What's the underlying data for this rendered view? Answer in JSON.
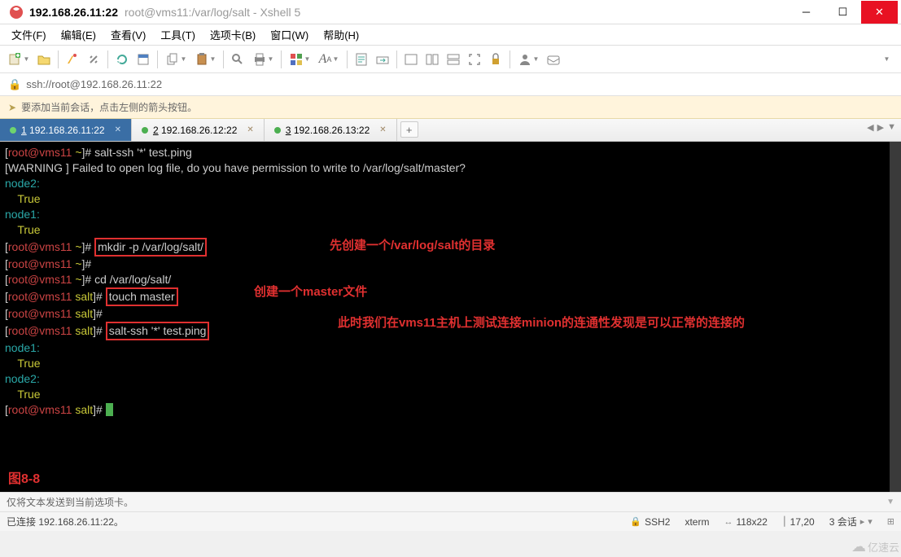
{
  "title": {
    "ip": "192.168.26.11:22",
    "path": "root@vms11:/var/log/salt - Xshell 5"
  },
  "menu": {
    "file": "文件(F)",
    "edit": "编辑(E)",
    "view": "查看(V)",
    "tools": "工具(T)",
    "tabs": "选项卡(B)",
    "window": "窗口(W)",
    "help": "帮助(H)"
  },
  "addr": {
    "url": "ssh://root@192.168.26.11:22"
  },
  "hint": {
    "text": "要添加当前会话，点击左侧的箭头按钮。"
  },
  "tabs": {
    "t1": {
      "num": "1",
      "label": "192.168.26.11:22"
    },
    "t2": {
      "num": "2",
      "label": "192.168.26.12:22"
    },
    "t3": {
      "num": "3",
      "label": "192.168.26.13:22"
    },
    "add": "+"
  },
  "term": {
    "l1_user": "root@vms11",
    "l1_path": "~",
    "l1_cmd": "salt-ssh '*' test.ping",
    "l2": "[WARNING ] Failed to open log file, do you have permission to write to /var/log/salt/master?",
    "n2": "node2",
    "n1": "node1",
    "colon": ":",
    "true": "True",
    "l6_cmd": "mkdir -p /var/log/salt/",
    "l8_cmd": "cd /var/log/salt/",
    "saltpath": "salt",
    "l9_cmd": "touch master",
    "l11_cmd": "salt-ssh '*' test.ping",
    "ann1": "先创建一个/var/log/salt的目录",
    "ann2": "创建一个master文件",
    "ann3": "此时我们在vms11主机上测试连接minion的连通性发现是可以正常的连接的",
    "fig": "图8-8"
  },
  "footer1": {
    "text": "仅将文本发送到当前选项卡。"
  },
  "footer2": {
    "status": "已连接 192.168.26.11:22。",
    "proto": "SSH2",
    "termtype": "xterm",
    "size": "118x22",
    "pos": "17,20",
    "sess": "3 会话"
  },
  "watermark": "亿速云"
}
